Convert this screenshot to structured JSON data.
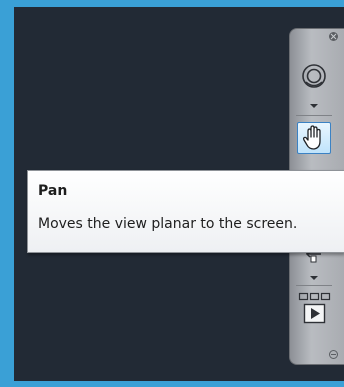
{
  "tooltip": {
    "title": "Pan",
    "description": "Moves the view planar to the screen."
  },
  "navigation_bar": {
    "tools": [
      {
        "name": "Steering Wheels",
        "icon": "steering-wheel-icon"
      },
      {
        "name": "Pan",
        "icon": "pan-hand-icon",
        "state": "hovered"
      },
      {
        "name": "Orbit",
        "icon": "orbit-icon"
      },
      {
        "name": "ShowMotion",
        "icon": "showmotion-icon"
      }
    ]
  },
  "colors": {
    "viewport_background": "#222a35",
    "window_border": "#3aa0d6",
    "hover_highlight": "#bfe3fb",
    "hover_border": "#3b82c4"
  }
}
